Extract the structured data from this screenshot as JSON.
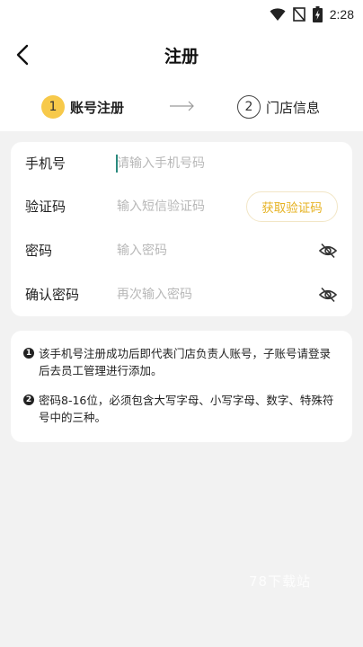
{
  "status_bar": {
    "time": "2:28"
  },
  "header": {
    "title": "注册"
  },
  "steps": {
    "step1": {
      "number": "1",
      "label": "账号注册"
    },
    "step2": {
      "number": "2",
      "label": "门店信息"
    }
  },
  "form": {
    "phone": {
      "label": "手机号",
      "placeholder": "请输入手机号码"
    },
    "code": {
      "label": "验证码",
      "placeholder": "输入短信验证码",
      "button": "获取验证码"
    },
    "password": {
      "label": "密码",
      "placeholder": "输入密码"
    },
    "confirm": {
      "label": "确认密码",
      "placeholder": "再次输入密码"
    }
  },
  "notice": {
    "items": [
      {
        "number": "1",
        "text": "该手机号注册成功后即代表门店负责人账号，子账号请登录后去员工管理进行添加。"
      },
      {
        "number": "2",
        "text": "密码8-16位，必须包含大写字母、小写字母、数字、特殊符号中的三种。"
      }
    ]
  },
  "watermark": "78下载站",
  "colors": {
    "accent": "#f7c94a",
    "code_text": "#e6b222",
    "caret": "#2a8a7e",
    "page_bg": "#f2f2f2"
  }
}
